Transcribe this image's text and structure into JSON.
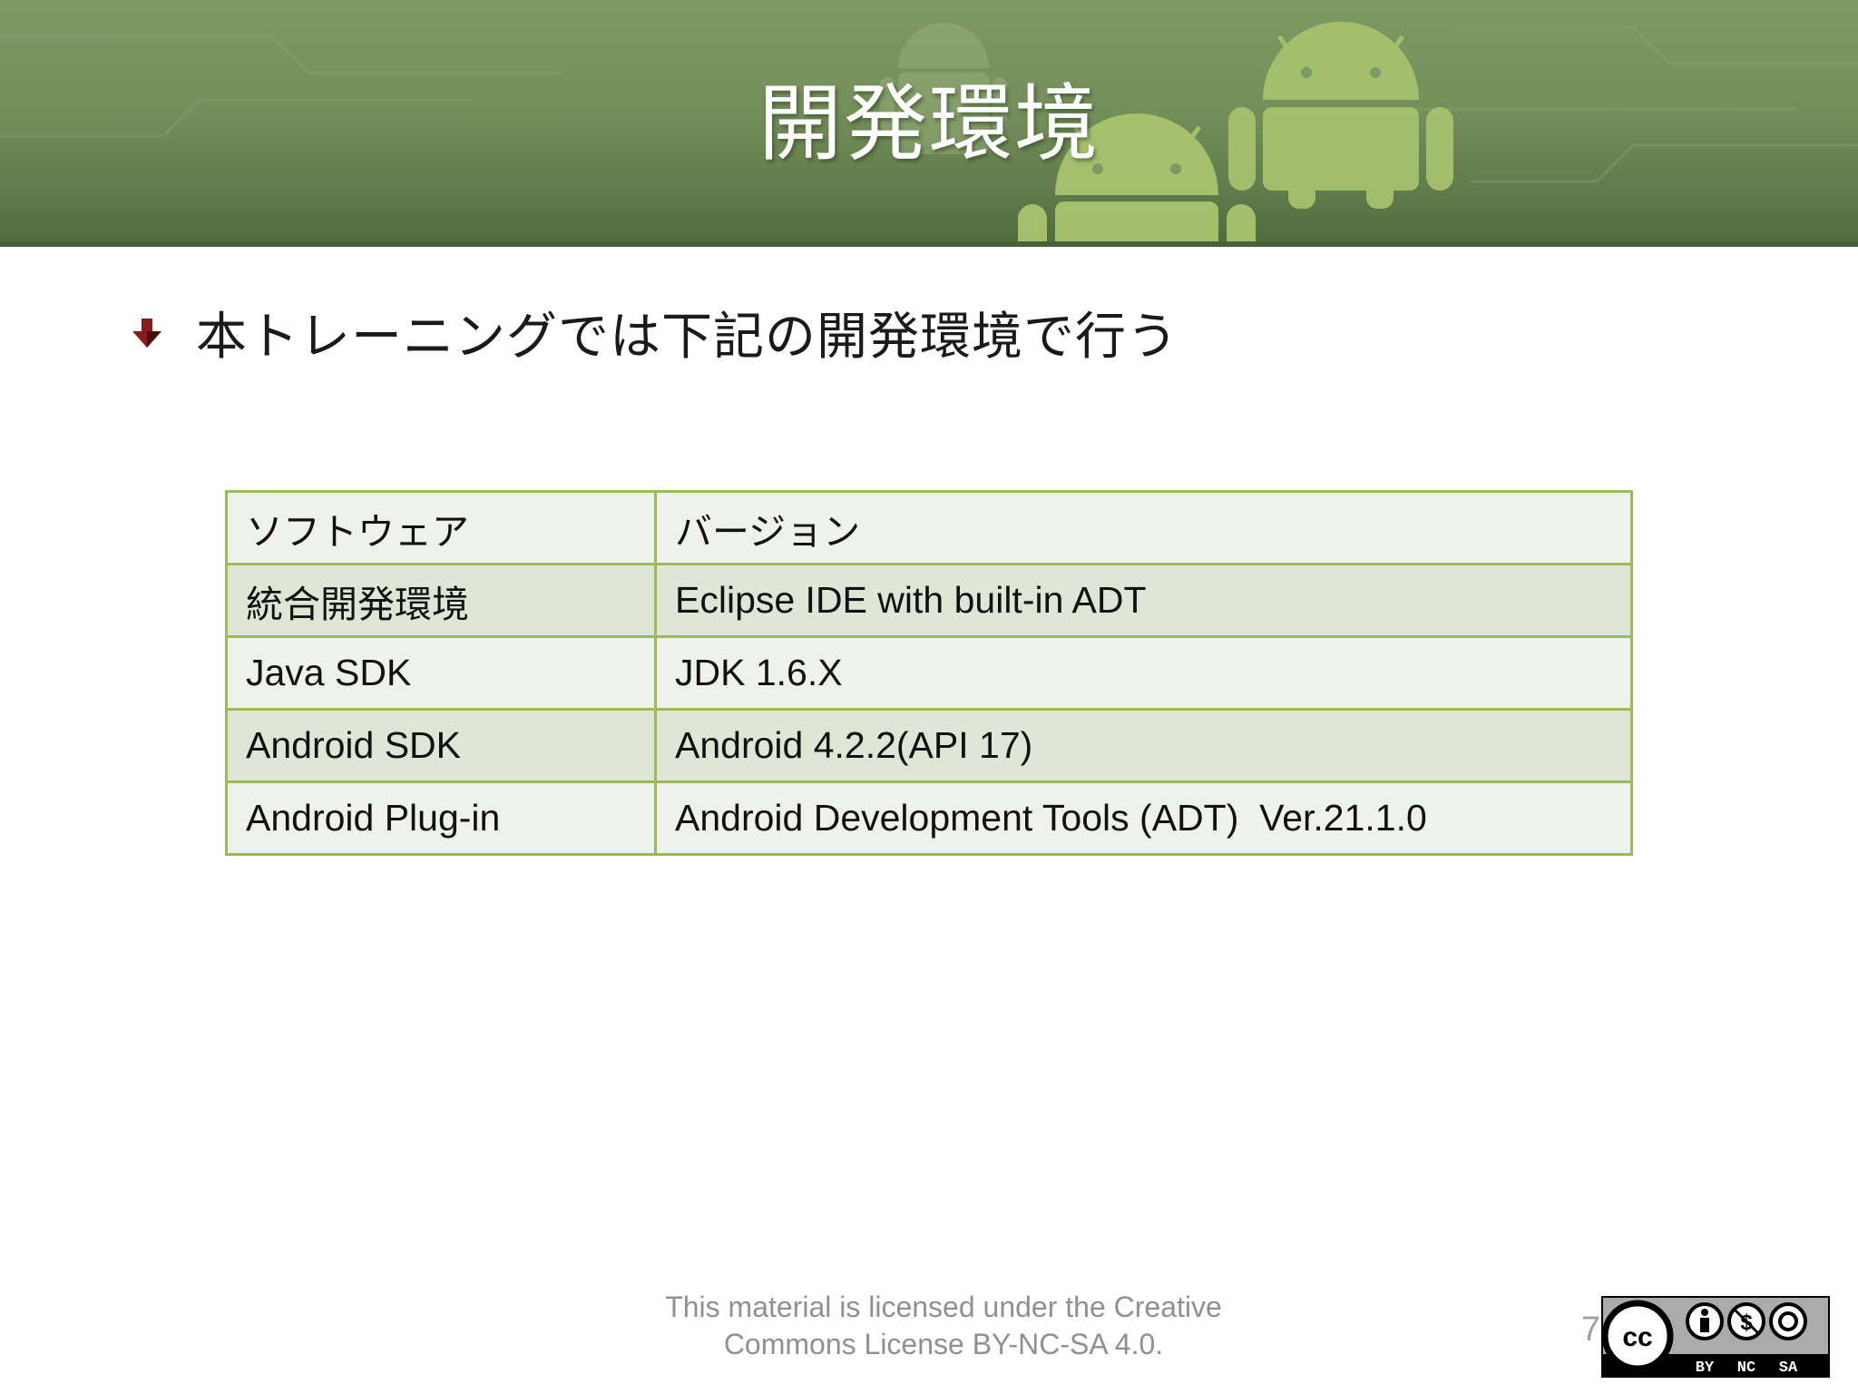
{
  "slide": {
    "title": "開発環境",
    "bullet": "本トレーニングでは下記の開発環境で行う",
    "page_number": "7"
  },
  "table": {
    "header": [
      "ソフトウェア",
      "バージョン"
    ],
    "rows": [
      [
        "統合開発環境",
        "Eclipse IDE with built-in ADT"
      ],
      [
        "Java SDK",
        "JDK 1.6.X"
      ],
      [
        "Android SDK",
        "Android 4.2.2(API 17)"
      ],
      [
        "Android Plug-in",
        "Android Development Tools (ADT)  Ver.21.1.0"
      ]
    ]
  },
  "footer": {
    "license_line1": "This material is licensed under the Creative",
    "license_line2": "Commons License BY-NC-SA 4.0.",
    "badge_labels": [
      "BY",
      "NC",
      "SA"
    ]
  },
  "colors": {
    "table_border": "#9bbb59",
    "row_light": "#eff2ec",
    "row_dark": "#dfe6d6",
    "bullet_accent": "#8b1a1a",
    "banner_green": "#7f9964"
  }
}
